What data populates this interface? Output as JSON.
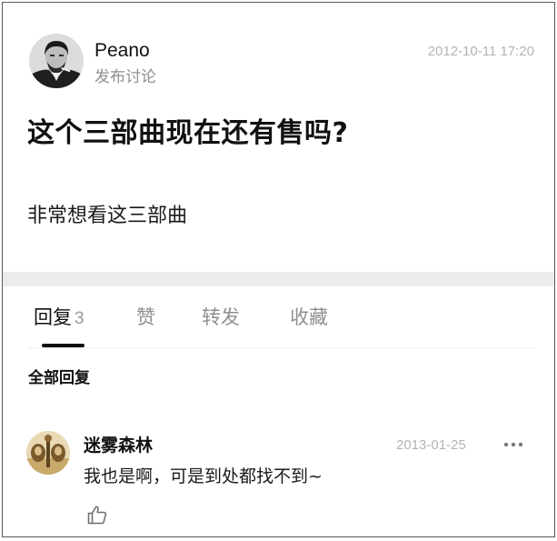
{
  "post": {
    "author_name": "Peano",
    "author_action": "发布讨论",
    "timestamp": "2012-10-11 17:20",
    "title": "这个三部曲现在还有售吗?",
    "body": "非常想看这三部曲",
    "author_avatar_icon": "portrait-avatar"
  },
  "tabs": {
    "replies_label": "回复",
    "replies_count": "3",
    "likes_label": "赞",
    "reposts_label": "转发",
    "favorites_label": "收藏",
    "active": "replies"
  },
  "replies_section": {
    "heading": "全部回复",
    "items": [
      {
        "author": "迷雾森林",
        "date": "2013-01-25",
        "text": "我也是啊，可是到处都找不到~",
        "avatar_icon": "sepia-photo-avatar",
        "more_icon": "more-dots-icon",
        "like_icon": "thumbs-up-icon"
      }
    ]
  },
  "colors": {
    "text_primary": "#111111",
    "text_secondary": "#8f8f8f",
    "timestamp": "#b4b4b4",
    "divider": "#ececec",
    "tab_indicator": "#111111"
  }
}
